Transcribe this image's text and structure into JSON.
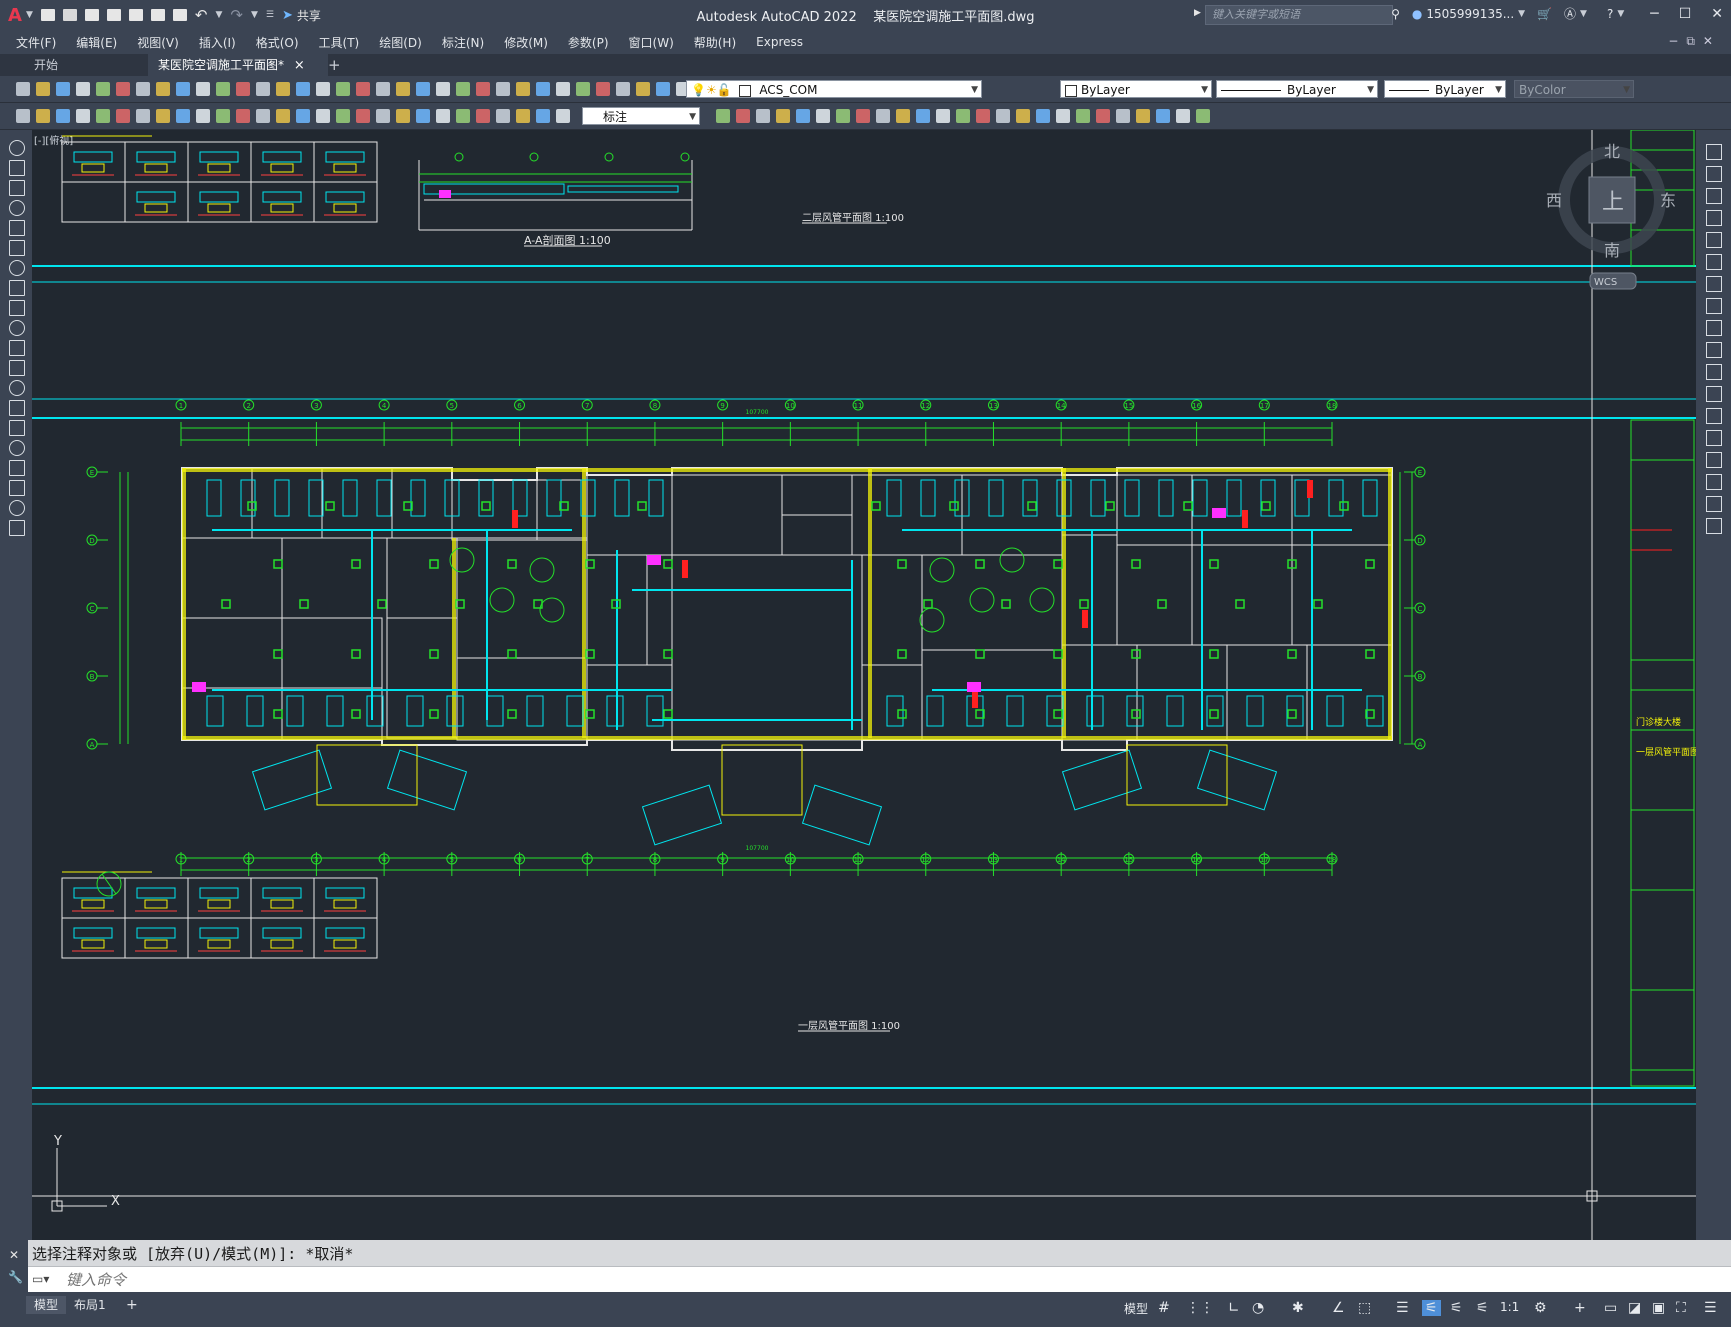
{
  "titlebar": {
    "app_title": "Autodesk AutoCAD 2022",
    "file_title": "某医院空调施工平面图.dwg",
    "share_label": "共享",
    "search_placeholder": "键入关键字或短语",
    "user_name": "1505999135..."
  },
  "menubar": {
    "items": [
      "文件(F)",
      "编辑(E)",
      "视图(V)",
      "插入(I)",
      "格式(O)",
      "工具(T)",
      "绘图(D)",
      "标注(N)",
      "修改(M)",
      "参数(P)",
      "窗口(W)",
      "帮助(H)",
      "Express"
    ]
  },
  "tabs": {
    "start": "开始",
    "doc": "某医院空调施工平面图*",
    "close": "×",
    "add": "+"
  },
  "toolbar": {
    "layer_name": "ACS_COM",
    "color": "ByLayer",
    "linetype": "ByLayer",
    "lineweight": "ByLayer",
    "plotstyle": "ByColor",
    "dimstyle": "标注"
  },
  "viewcube": {
    "north": "北",
    "south": "南",
    "east": "东",
    "west": "西",
    "face": "上",
    "wcs": "WCS"
  },
  "viewport_label": "[-][俯视]",
  "drawing": {
    "section_title": "A-A剖面图 1:100",
    "upper_plan_title": "二层风管平面图 1:100",
    "lower_plan_title": "一层风管平面图 1:100",
    "grid_numbers": [
      "1",
      "2",
      "3",
      "4",
      "5",
      "6",
      "7",
      "8",
      "9",
      "10",
      "11",
      "12",
      "13",
      "14",
      "15",
      "16",
      "17",
      "18"
    ],
    "grid_letters": [
      "E",
      "D",
      "C",
      "B",
      "A"
    ],
    "total_dim": "107700",
    "title_block_project": "门诊楼大楼",
    "title_block_drawing": "一层风管平面图"
  },
  "ucs": {
    "x": "X",
    "y": "Y"
  },
  "command": {
    "history": "选择注释对象或 [放弃(U)/模式(M)]: *取消*",
    "placeholder": "键入命令"
  },
  "status": {
    "model_tab": "模型",
    "layout_tab": "布局1",
    "add": "+",
    "model_btn": "模型",
    "scale": "1:1"
  },
  "colors": {
    "canvas": "#212830",
    "chrome": "#3b4453",
    "cyan": "#00e5ee",
    "green": "#25e02a",
    "yellow": "#f2f20a",
    "red": "#ff2020",
    "magenta": "#ff30ff"
  }
}
